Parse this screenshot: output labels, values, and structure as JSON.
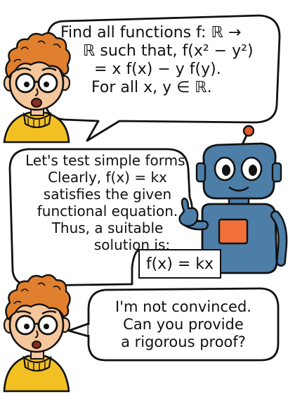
{
  "panel1": {
    "speaker": "human",
    "lines": [
      "Find all functions f: ℝ →",
      "ℝ such that, f(x² − y²)",
      "= x f(x) − y f(y).",
      "For all x, y ∈ ℝ."
    ]
  },
  "panel2": {
    "speaker": "robot",
    "lines": [
      "Let's test simple forms.",
      "Clearly, f(x) = kx",
      "satisfies the given",
      "functional equation.",
      "Thus, a suitable",
      "solution is:"
    ],
    "answer": "f(x) = kx"
  },
  "panel3": {
    "speaker": "human",
    "lines": [
      "I'm not convinced.",
      "Can you provide",
      "a rigorous proof?"
    ]
  },
  "colors": {
    "hair": "#e0802e",
    "skin": "#f6c79c",
    "sweater": "#f3c023",
    "robot_body": "#4d7ea8",
    "robot_panel": "#f07038",
    "robot_antenna": "#e35a2a",
    "outline": "#111111"
  }
}
